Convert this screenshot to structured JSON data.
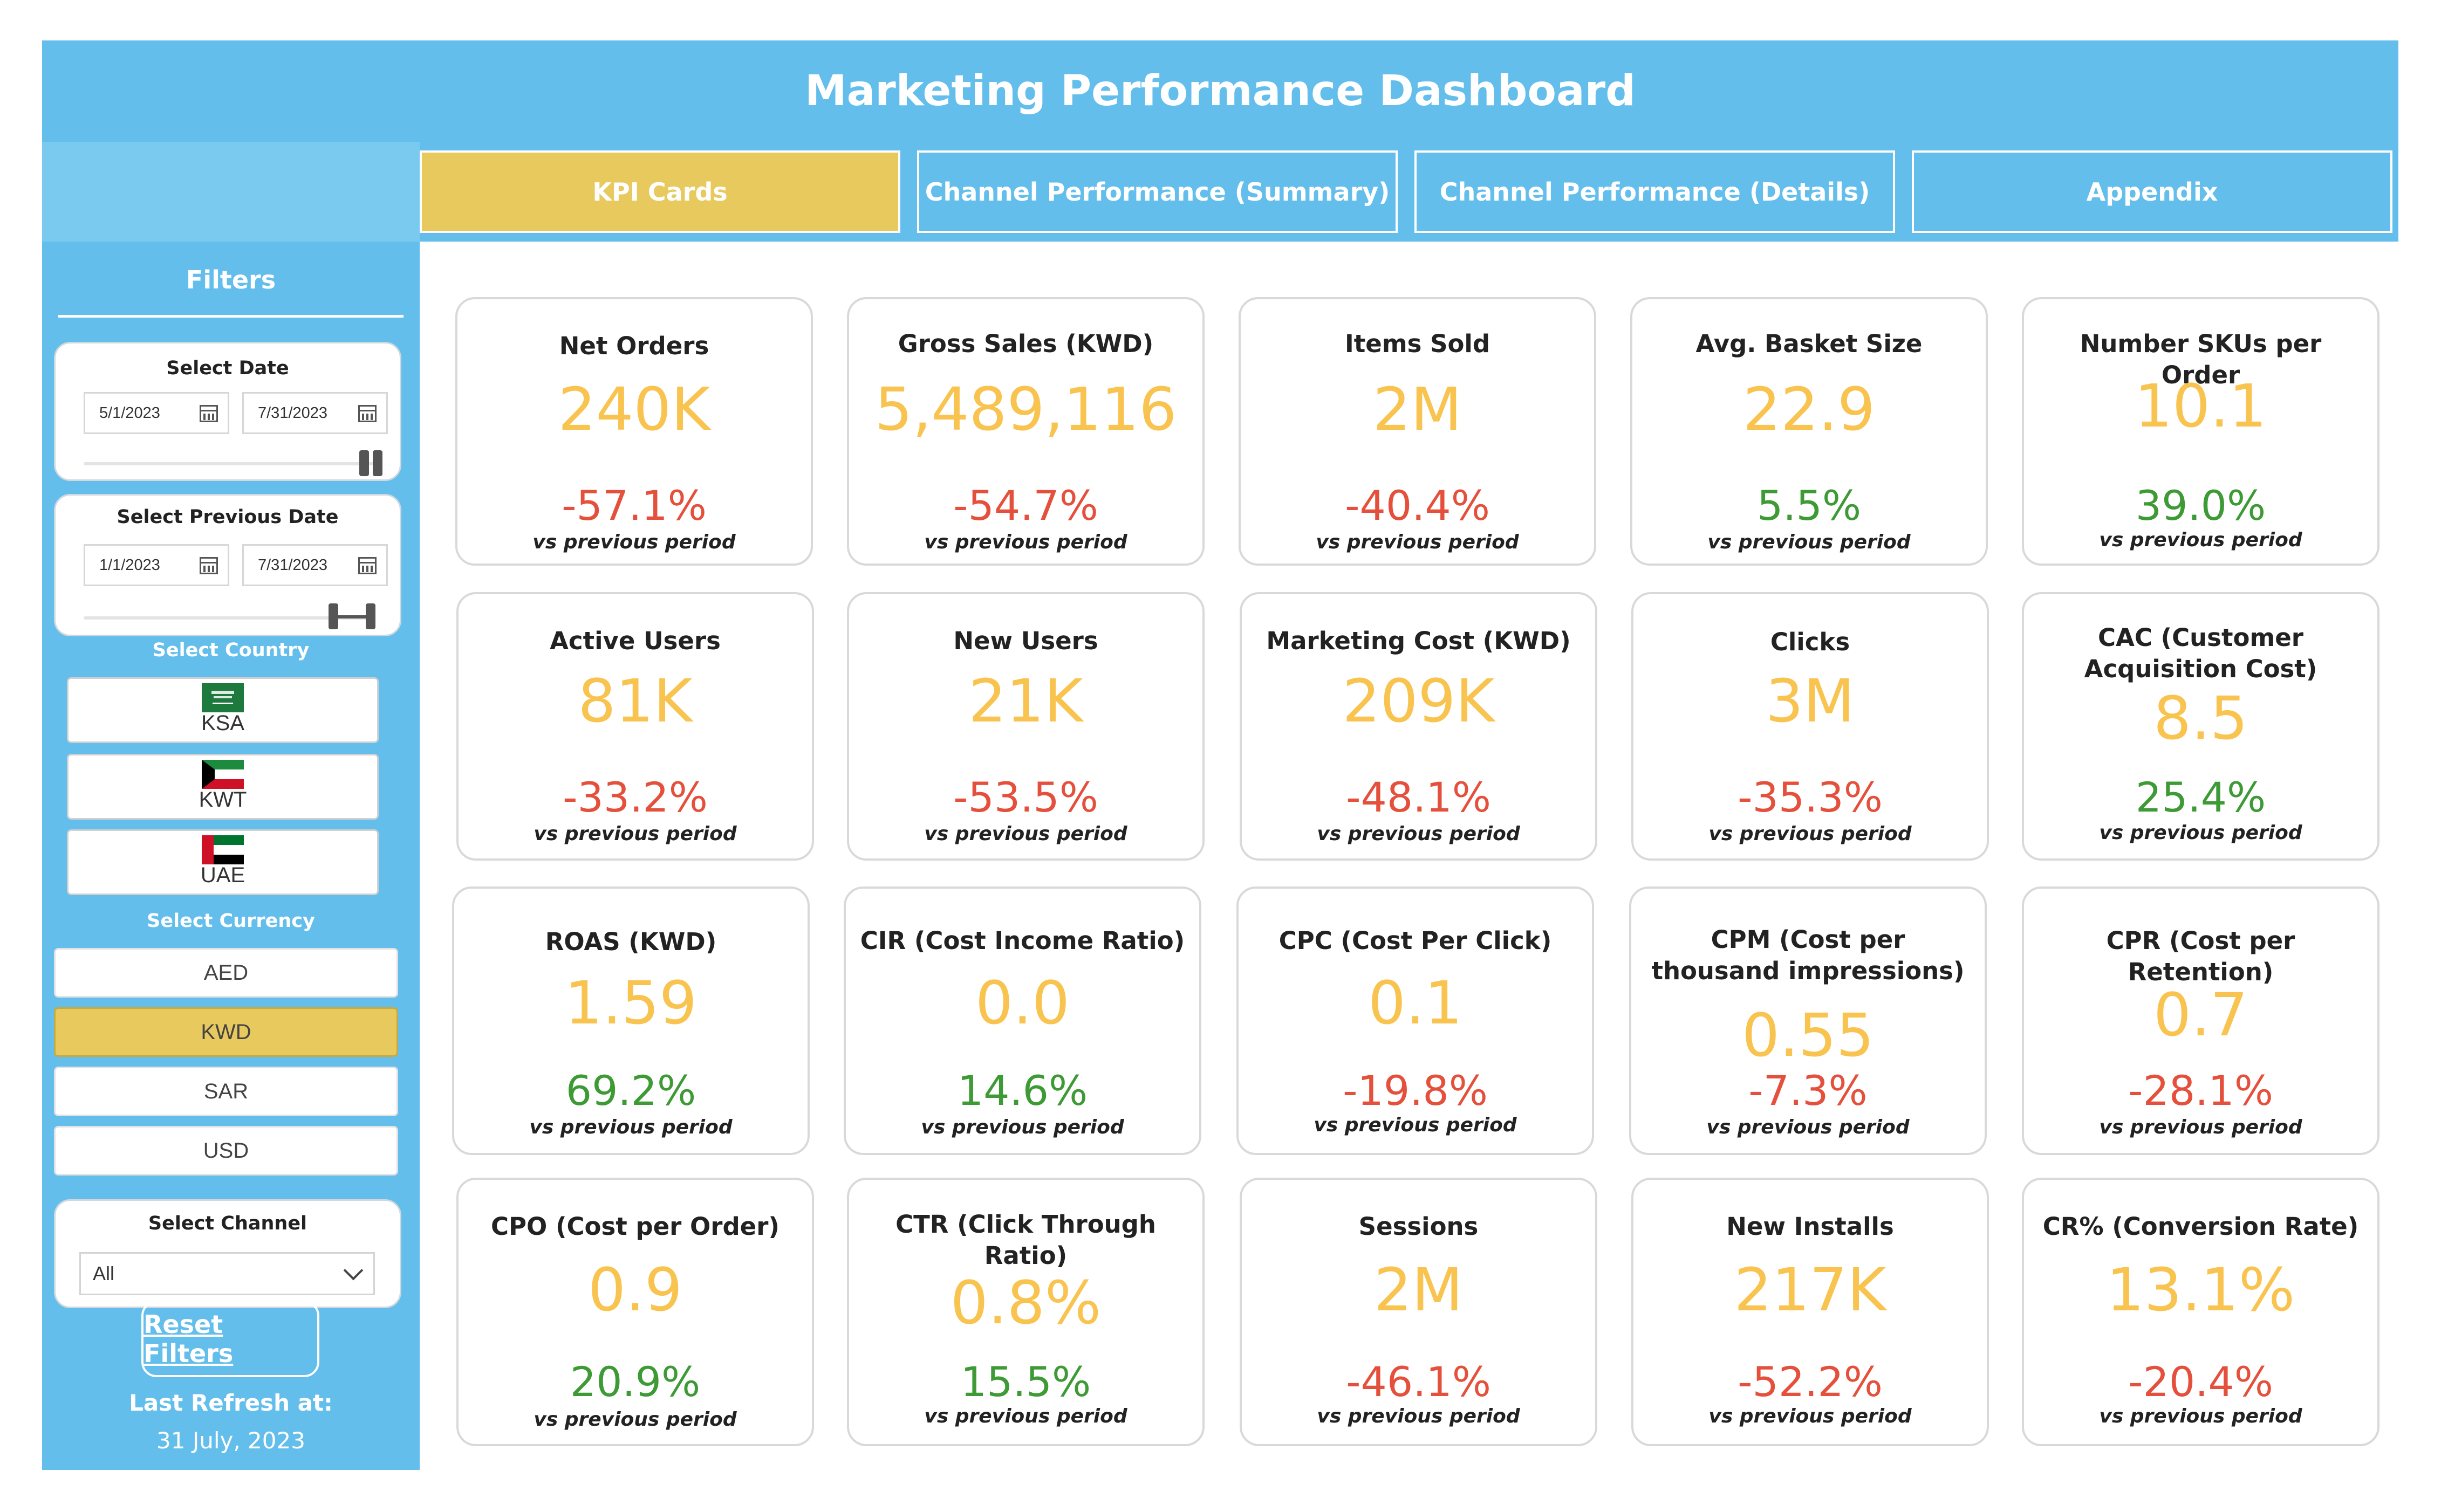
{
  "header": {
    "title": "Marketing Performance Dashboard"
  },
  "tabs": [
    {
      "label": "KPI Cards",
      "active": true
    },
    {
      "label": "Channel Performance (Summary)",
      "active": false
    },
    {
      "label": "Channel Performance (Details)",
      "active": false
    },
    {
      "label": "Appendix",
      "active": false
    }
  ],
  "sidebar": {
    "title": "Filters",
    "date": {
      "label": "Select Date",
      "start": "5/1/2023",
      "end": "7/31/2023"
    },
    "previous_date": {
      "label": "Select Previous Date",
      "start": "1/1/2023",
      "end": "7/31/2023"
    },
    "country": {
      "label": "Select Country",
      "options": [
        {
          "label": "KSA",
          "flag": "saudi-arabia-flag"
        },
        {
          "label": "KWT",
          "flag": "kuwait-flag"
        },
        {
          "label": "UAE",
          "flag": "uae-flag"
        }
      ]
    },
    "currency": {
      "label": "Select Currency",
      "options": [
        "AED",
        "KWD",
        "SAR",
        "USD"
      ],
      "selected": "KWD"
    },
    "channel": {
      "label": "Select Channel",
      "value": "All"
    },
    "reset_label": "Reset Filters",
    "refresh_label": "Last Refresh at:",
    "refresh_date": "31 July, 2023"
  },
  "colors": {
    "header_blue": "#63BEEC",
    "active_tab": "#E8C95E",
    "value_yellow": "#F9C34F",
    "negative_red": "#E5503C",
    "positive_green": "#3D9A35"
  },
  "cards": [
    {
      "title": "Net Orders",
      "value": "240K",
      "change": "-57.1%",
      "trend": "negative",
      "sub": "vs previous period"
    },
    {
      "title": "Gross Sales (KWD)",
      "value": "5,489,116",
      "change": "-54.7%",
      "trend": "negative",
      "sub": "vs previous period"
    },
    {
      "title": "Items Sold",
      "value": "2M",
      "change": "-40.4%",
      "trend": "negative",
      "sub": "vs previous period"
    },
    {
      "title": "Avg. Basket Size",
      "value": "22.9",
      "change": "5.5%",
      "trend": "positive",
      "sub": "vs previous period"
    },
    {
      "title": "Number SKUs per Order",
      "value": "10.1",
      "change": "39.0%",
      "trend": "positive",
      "sub": "vs previous period"
    },
    {
      "title": "Active Users",
      "value": "81K",
      "change": "-33.2%",
      "trend": "negative",
      "sub": "vs previous period"
    },
    {
      "title": "New Users",
      "value": "21K",
      "change": "-53.5%",
      "trend": "negative",
      "sub": "vs previous period"
    },
    {
      "title": "Marketing Cost (KWD)",
      "value": "209K",
      "change": "-48.1%",
      "trend": "negative",
      "sub": "vs previous period"
    },
    {
      "title": "Clicks",
      "value": "3M",
      "change": "-35.3%",
      "trend": "negative",
      "sub": "vs previous period"
    },
    {
      "title": "CAC (Customer Acquisition Cost)",
      "value": "8.5",
      "change": "25.4%",
      "trend": "positive",
      "sub": "vs previous period"
    },
    {
      "title": "ROAS (KWD)",
      "value": "1.59",
      "change": "69.2%",
      "trend": "positive",
      "sub": "vs previous period"
    },
    {
      "title": "CIR (Cost Income Ratio)",
      "value": "0.0",
      "change": "14.6%",
      "trend": "positive",
      "sub": "vs previous period"
    },
    {
      "title": "CPC (Cost Per Click)",
      "value": "0.1",
      "change": "-19.8%",
      "trend": "negative",
      "sub": "vs previous period"
    },
    {
      "title": "CPM (Cost per thousand impressions)",
      "value": "0.55",
      "change": "-7.3%",
      "trend": "negative",
      "sub": "vs previous period"
    },
    {
      "title": "CPR (Cost per Retention)",
      "value": "0.7",
      "change": "-28.1%",
      "trend": "negative",
      "sub": "vs previous period"
    },
    {
      "title": "CPO (Cost per Order)",
      "value": "0.9",
      "change": "20.9%",
      "trend": "positive",
      "sub": "vs previous period"
    },
    {
      "title": "CTR (Click Through Ratio)",
      "value": "0.8%",
      "change": "15.5%",
      "trend": "positive",
      "sub": "vs previous period"
    },
    {
      "title": "Sessions",
      "value": "2M",
      "change": "-46.1%",
      "trend": "negative",
      "sub": "vs previous period"
    },
    {
      "title": "New Installs",
      "value": "217K",
      "change": "-52.2%",
      "trend": "negative",
      "sub": "vs previous period"
    },
    {
      "title": "CR% (Conversion Rate)",
      "value": "13.1%",
      "change": "-20.4%",
      "trend": "negative",
      "sub": "vs previous period"
    }
  ]
}
